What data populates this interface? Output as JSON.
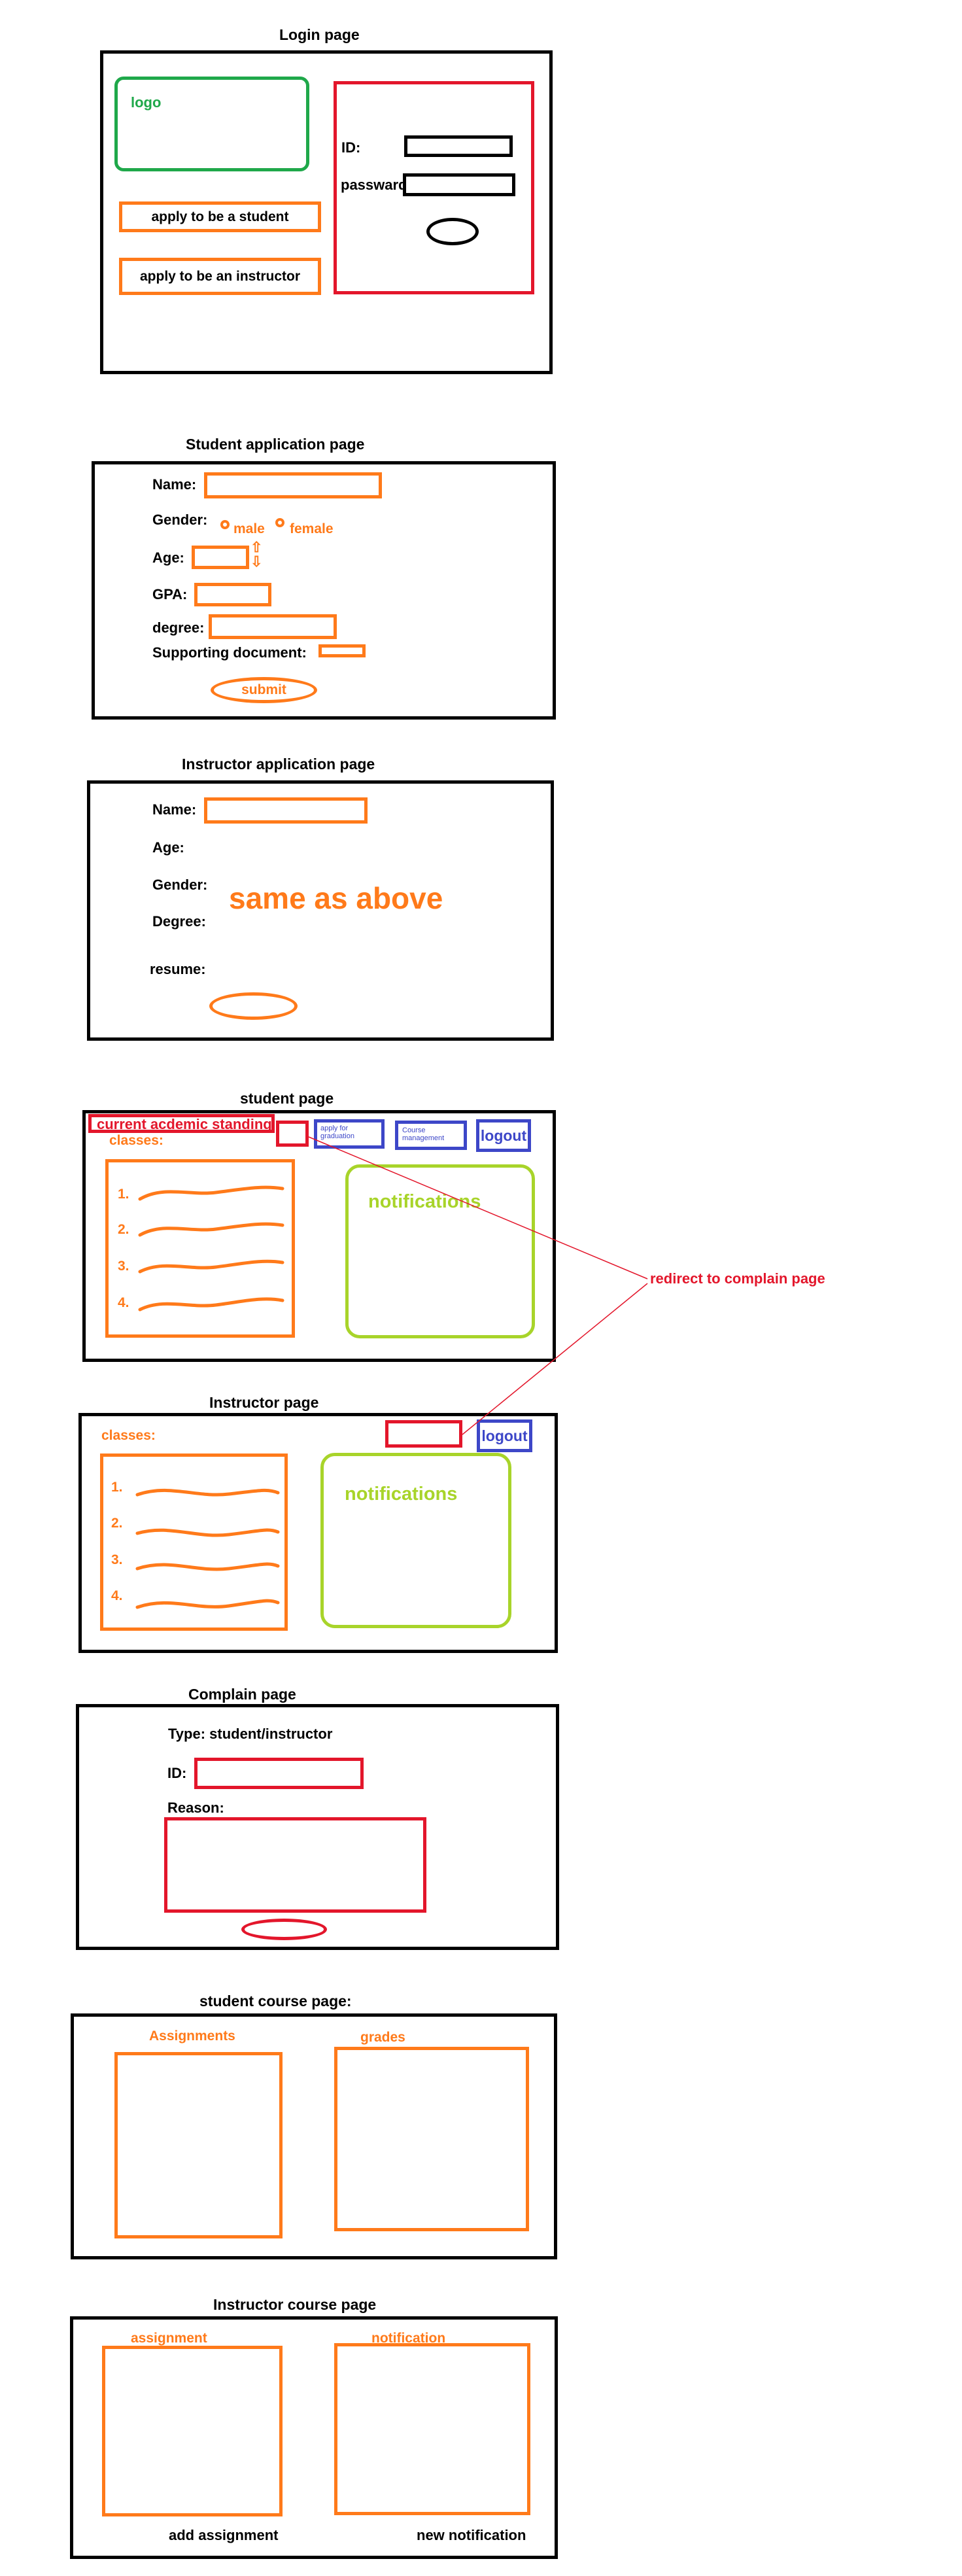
{
  "login": {
    "title": "Login page",
    "logo": "logo",
    "apply_student": "apply to be a student",
    "apply_instructor": "apply to be an instructor",
    "id_label": "ID:",
    "password_label": "passward"
  },
  "student_app": {
    "title": "Student application page",
    "name_label": "Name:",
    "gender_label": "Gender:",
    "male": "male",
    "female": "female",
    "age_label": "Age:",
    "gpa_label": "GPA:",
    "degree_label": "degree:",
    "supporting_label": "Supporting document:",
    "submit": "submit"
  },
  "instructor_app": {
    "title": "Instructor application page",
    "name_label": "Name:",
    "age_label": "Age:",
    "gender_label": "Gender:",
    "degree_label": "Degree:",
    "resume_label": "resume:",
    "note": "same as above"
  },
  "student_page": {
    "title": "student page",
    "standing": "current acdemic standing",
    "classes": "classes:",
    "apply_graduation": "apply for graduation",
    "course_management": "Course management",
    "logout": "logout",
    "notifications": "notifications",
    "numbers": [
      "1.",
      "2.",
      "3.",
      "4."
    ]
  },
  "redirect_note": "redirect to complain page",
  "instructor_page": {
    "title": "Instructor page",
    "classes": "classes:",
    "logout": "logout",
    "notifications": "notifications",
    "numbers": [
      "1.",
      "2.",
      "3.",
      "4."
    ]
  },
  "complain": {
    "title": "Complain page",
    "type_label": "Type: student/instructor",
    "id_label": "ID:",
    "reason_label": "Reason:"
  },
  "student_course": {
    "title": "student course page:",
    "assignments": "Assignments",
    "grades": "grades"
  },
  "instructor_course": {
    "title": "Instructor course page",
    "assignment": "assignment",
    "notification": "notification",
    "add_assignment": "add assignment",
    "new_notification": "new notification"
  }
}
